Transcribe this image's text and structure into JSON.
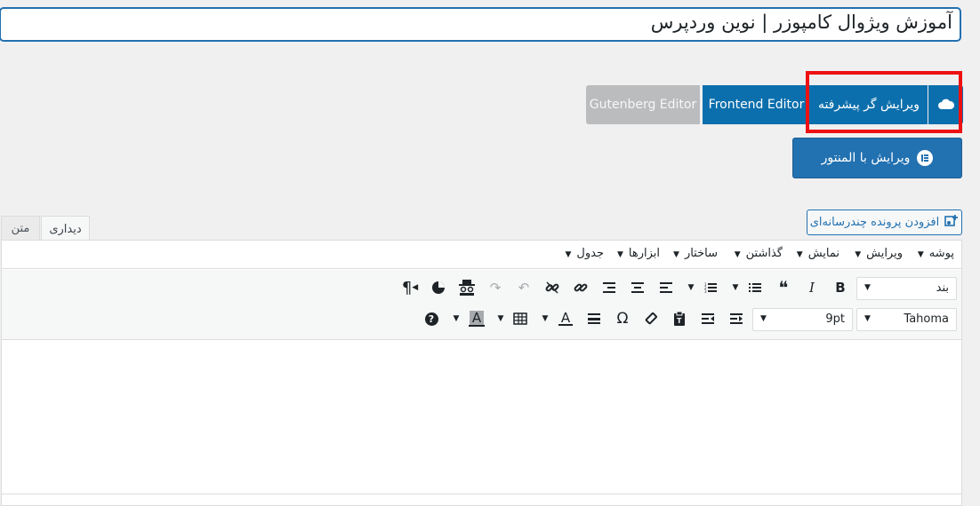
{
  "post": {
    "title": "آموزش ویژوال کامپوزر | نوین وردپرس"
  },
  "builders": {
    "gutenberg": "Gutenberg Editor",
    "frontend": "Frontend Editor",
    "advanced": "ویرایش گر پیشرفته",
    "elementor": "ویرایش با المنتور",
    "elementor_icon": "elementor-e-icon",
    "cloud_icon": "cloud-icon",
    "highlight_color": "#ee1111",
    "primary_color": "#0c6fad"
  },
  "media": {
    "add_media": "افزودن پرونده چندرسانه‌ای",
    "icon": "add-media-icon"
  },
  "tabs": {
    "visual": "دیداری",
    "text": "متن"
  },
  "menubar": {
    "items": [
      "پوشه",
      "ویرایش",
      "نمایش",
      "گذاشتن",
      "ساختار",
      "ابزارها",
      "جدول"
    ]
  },
  "toolbar": {
    "format_select": "بند",
    "font_family": "Tahoma",
    "font_size": "9pt",
    "row1_icons": [
      "bold-icon",
      "italic-icon",
      "blockquote-icon",
      "bullet-list-icon",
      "numbered-list-icon",
      "align-left-icon",
      "align-center-icon",
      "align-right-icon",
      "link-icon",
      "unlink-icon",
      "undo-icon",
      "redo-icon",
      "spy-icon",
      "pie-chart-icon",
      "paragraph-rtl-icon"
    ],
    "row2_icons": [
      "indent-icon",
      "outdent-icon",
      "paste-text-icon",
      "clear-formatting-icon",
      "omega-icon",
      "horizontal-line-icon",
      "text-color-icon",
      "table-icon",
      "background-color-icon",
      "help-icon"
    ],
    "glyphs": {
      "bold": "B",
      "italic": "I",
      "quote": "❝",
      "omega": "Ω",
      "text_color": "A",
      "bg_color": "A",
      "help": "?",
      "paragraph": "¶"
    }
  }
}
